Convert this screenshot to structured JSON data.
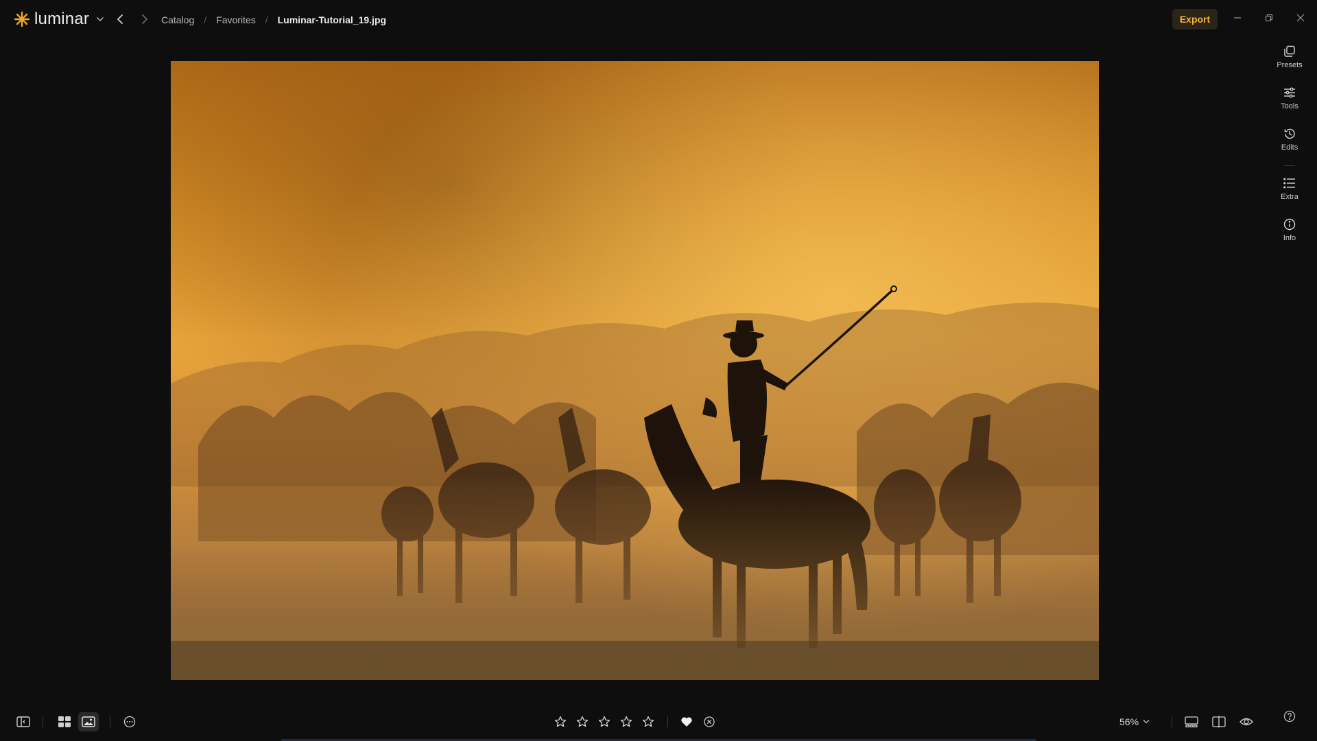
{
  "app": {
    "name": "luminar",
    "accent_color": "#f5a623"
  },
  "breadcrumb": {
    "items": [
      "Catalog",
      "Favorites"
    ],
    "current": "Luminar-Tutorial_19.jpg",
    "separator": "/"
  },
  "toolbar": {
    "export_label": "Export"
  },
  "right_panel": {
    "items": [
      {
        "label": "Presets",
        "icon": "presets-icon"
      },
      {
        "label": "Tools",
        "icon": "sliders-icon"
      },
      {
        "label": "Edits",
        "icon": "history-icon"
      },
      {
        "label": "Extra",
        "icon": "list-icon"
      },
      {
        "label": "Info",
        "icon": "info-icon"
      }
    ]
  },
  "bottom_bar": {
    "zoom": "56%",
    "rating": 0,
    "rating_max": 5,
    "favorite": true
  },
  "photo": {
    "subject": "cowboy on horseback herding horses in golden dust at sunset"
  }
}
